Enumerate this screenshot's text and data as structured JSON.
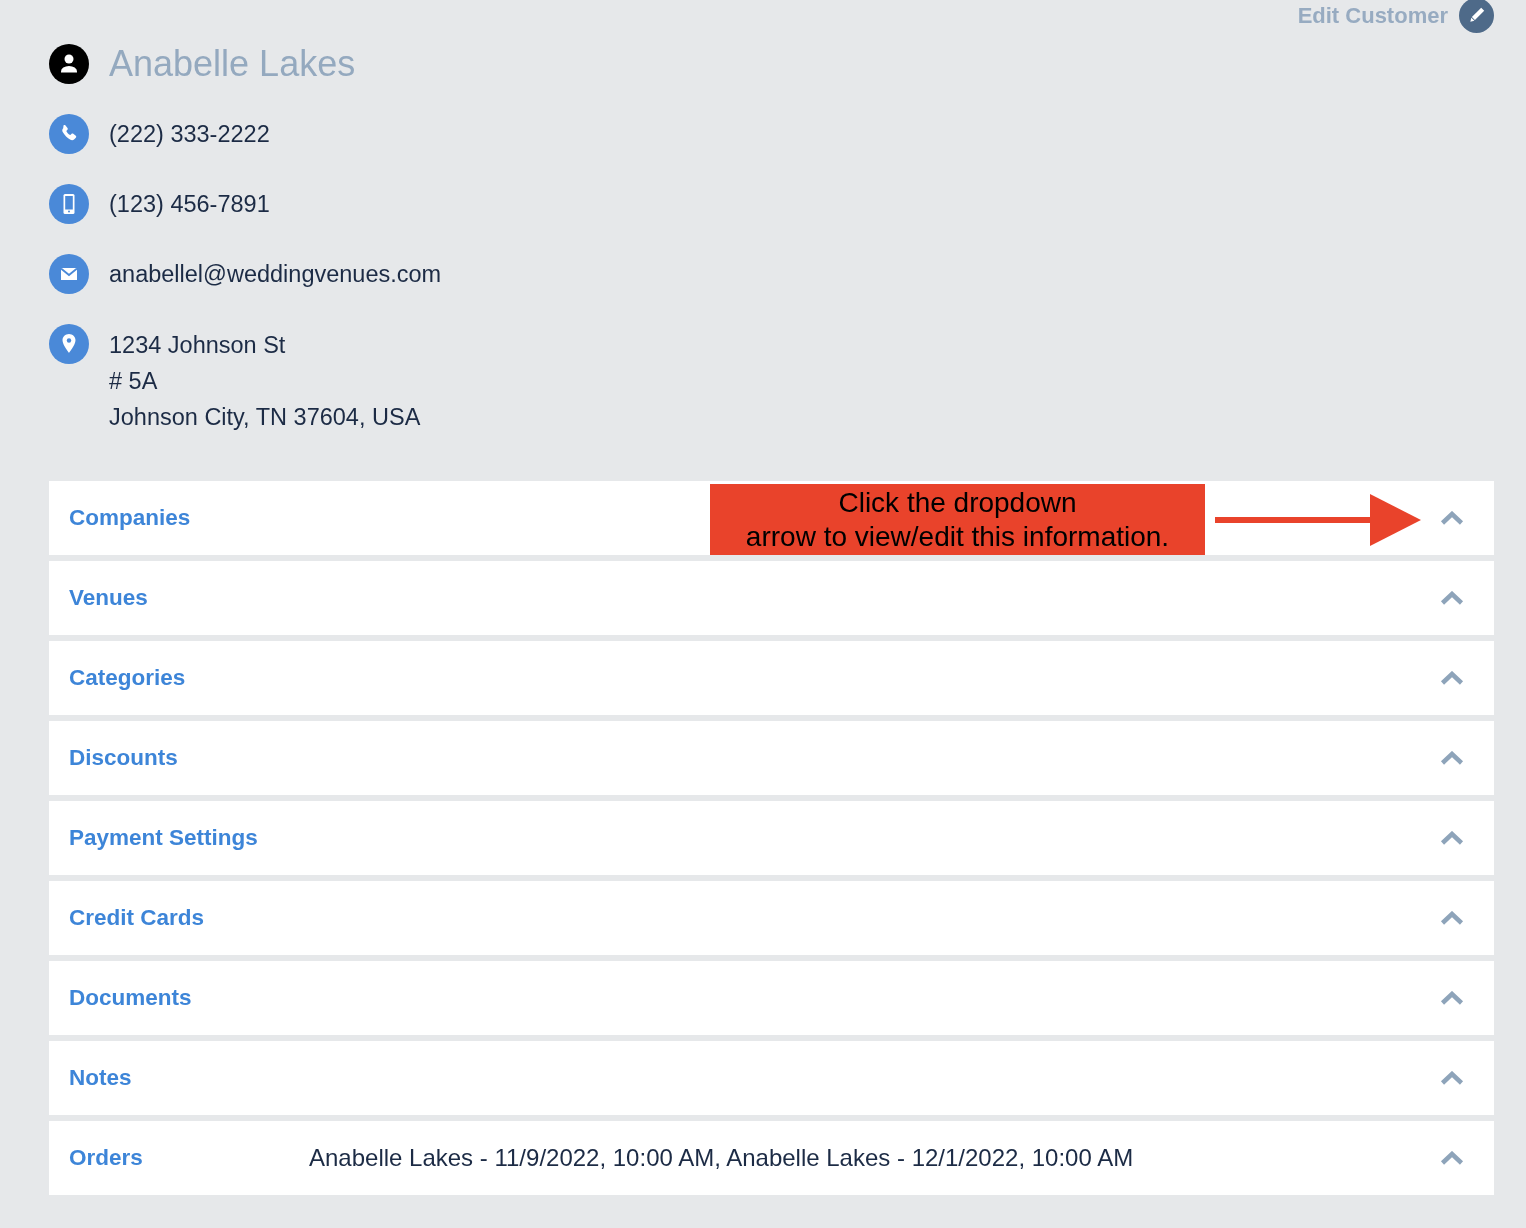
{
  "edit_button": {
    "label": "Edit Customer"
  },
  "customer": {
    "name": "Anabelle Lakes"
  },
  "contacts": [
    {
      "kind": "phone",
      "lines": [
        "(222) 333-2222"
      ]
    },
    {
      "kind": "mobile",
      "lines": [
        "(123) 456-7891"
      ]
    },
    {
      "kind": "email",
      "lines": [
        "anabellel@weddingvenues.com"
      ]
    },
    {
      "kind": "address",
      "lines": [
        "1234 Johnson St",
        "# 5A",
        "Johnson City, TN 37604, USA"
      ]
    }
  ],
  "sections": [
    {
      "title": "Companies",
      "callout": {
        "lines": [
          "Click the dropdown",
          "arrow to view/edit this information."
        ]
      }
    },
    {
      "title": "Venues"
    },
    {
      "title": "Categories"
    },
    {
      "title": "Discounts"
    },
    {
      "title": "Payment Settings"
    },
    {
      "title": "Credit Cards"
    },
    {
      "title": "Documents"
    },
    {
      "title": "Notes"
    },
    {
      "title": "Orders",
      "value": "Anabelle Lakes - 11/9/2022, 10:00 AM, Anabelle Lakes - 12/1/2022, 10:00 AM"
    }
  ]
}
